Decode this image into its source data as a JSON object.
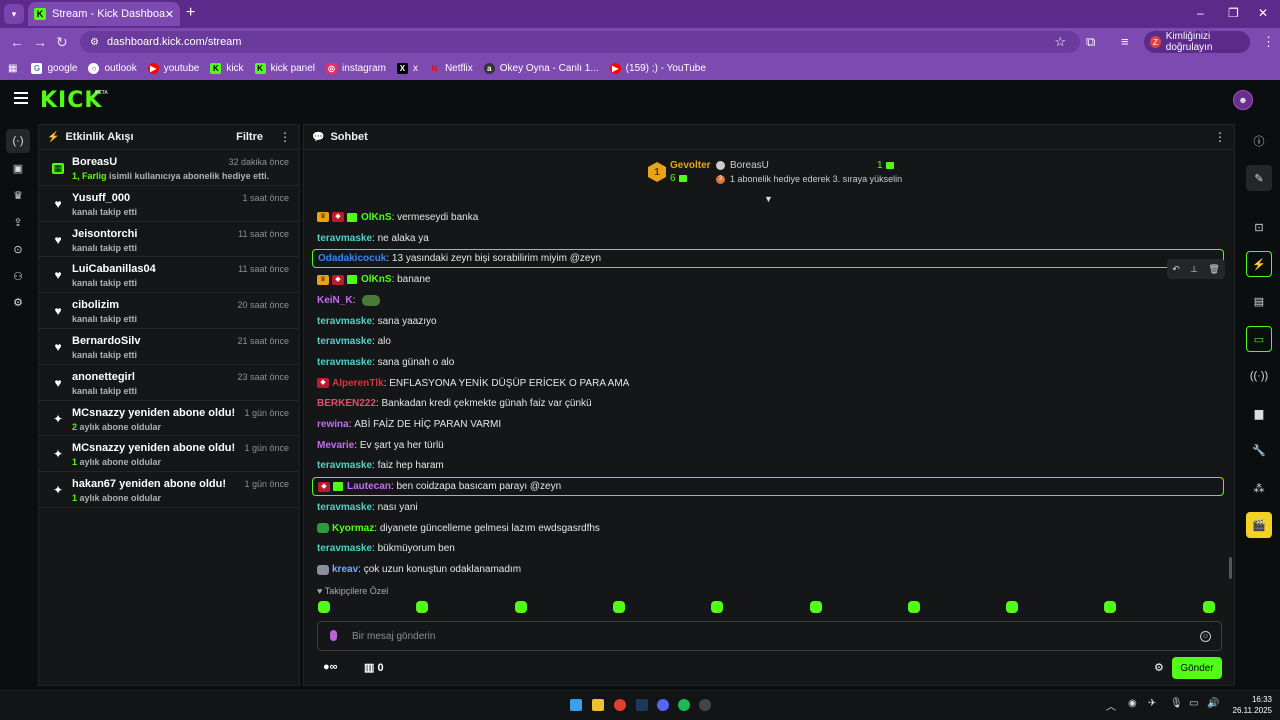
{
  "browser": {
    "tab_title": "Stream - Kick Dashboard",
    "url": "dashboard.kick.com/stream",
    "profile_label": "Kimliğinizi doğrulayın",
    "profile_initial": "Z",
    "bookmarks": [
      {
        "label": "google",
        "color": "#ffffff"
      },
      {
        "label": "outlook",
        "color": "#ffffff"
      },
      {
        "label": "youtube",
        "color": "#ff0000"
      },
      {
        "label": "kick",
        "color": "#53fc18"
      },
      {
        "label": "kick panel",
        "color": "#53fc18"
      },
      {
        "label": "instagram",
        "color": "#e1306c"
      },
      {
        "label": "x",
        "color": "#000000"
      },
      {
        "label": "Netflix",
        "color": "#e50914"
      },
      {
        "label": "Okey Oyna - Canlı 1...",
        "color": "#333333"
      },
      {
        "label": "(159) ;) - YouTube",
        "color": "#ff0000"
      }
    ]
  },
  "kick": {
    "logo": "KICK",
    "beta": "BETA"
  },
  "activity": {
    "title": "Etkinlik Akışı",
    "filter": "Filtre",
    "items": [
      {
        "name": "BoreasU",
        "sub_hl": "1, Farlig",
        "sub": " isimli kullanıcıya abonelik hediye etti.",
        "time": "32 dakika önce",
        "icon": "gift-icon"
      },
      {
        "name": "Yusuff_000",
        "sub_hl": "",
        "sub": "kanalı takip etti",
        "time": "1 saat önce",
        "icon": "heart-icon"
      },
      {
        "name": "Jeisontorchi",
        "sub_hl": "",
        "sub": "kanalı takip etti",
        "time": "11 saat önce",
        "icon": "heart-icon"
      },
      {
        "name": "LuiCabanillas04",
        "sub_hl": "",
        "sub": "kanalı takip etti",
        "time": "11 saat önce",
        "icon": "heart-icon"
      },
      {
        "name": "cibolizim",
        "sub_hl": "",
        "sub": "kanalı takip etti",
        "time": "20 saat önce",
        "icon": "heart-icon"
      },
      {
        "name": "BernardoSilv",
        "sub_hl": "",
        "sub": "kanalı takip etti",
        "time": "21 saat önce",
        "icon": "heart-icon"
      },
      {
        "name": "anonettegirl",
        "sub_hl": "",
        "sub": "kanalı takip etti",
        "time": "23 saat önce",
        "icon": "heart-icon"
      },
      {
        "name": "MCsnazzy yeniden abone oldu!",
        "sub_hl": "2",
        "sub": " aylık abone oldular",
        "time": "1 gün önce",
        "icon": "sparkle-icon"
      },
      {
        "name": "MCsnazzy yeniden abone oldu!",
        "sub_hl": "1",
        "sub": " aylık abone oldular",
        "time": "1 gün önce",
        "icon": "sparkle-icon"
      },
      {
        "name": "hakan67 yeniden abone oldu!",
        "sub_hl": "1",
        "sub": " aylık abone oldular",
        "time": "1 gün önce",
        "icon": "sparkle-icon"
      }
    ]
  },
  "chat": {
    "title": "Sohbet",
    "leaderboard": {
      "rank1": "1",
      "name1": "Gevolter",
      "count1": "6",
      "name2": "BoreasU",
      "count2": "1",
      "rank2": "3",
      "text2": "1 abonelik hediye ederek 3. sıraya yükselin"
    },
    "messages": [
      {
        "badges": [
          "crown",
          "red",
          "gift"
        ],
        "user": "OlKnS",
        "color": "#53fc18",
        "text": "vermeseydi banka",
        "hl": false
      },
      {
        "badges": [],
        "user": "teravmaske",
        "color": "#4fd1c5",
        "text": "ne alaka ya",
        "hl": false
      },
      {
        "badges": [],
        "user": "Odadakicocuk",
        "color": "#3b82f6",
        "text": "13 yasındaki zeyn bişi sorabilirim miyim @zeyn",
        "hl": true
      },
      {
        "badges": [
          "crown",
          "red",
          "gift"
        ],
        "user": "OlKnS",
        "color": "#53fc18",
        "text": "banane",
        "hl": false
      },
      {
        "badges": [],
        "user": "KeiN_K",
        "color": "#c46cf0",
        "text": "",
        "emote": true,
        "hl": false
      },
      {
        "badges": [],
        "user": "teravmaske",
        "color": "#4fd1c5",
        "text": "sana yaazıyo",
        "hl": false
      },
      {
        "badges": [],
        "user": "teravmaske",
        "color": "#4fd1c5",
        "text": "alo",
        "hl": false
      },
      {
        "badges": [],
        "user": "teravmaske",
        "color": "#4fd1c5",
        "text": "sana günah o alo",
        "hl": false
      },
      {
        "badges": [
          "red"
        ],
        "user": "AlperenTlk",
        "color": "#e0303a",
        "text": "ENFLASYONA YENİK DÜŞÜP ERİCEK O PARA AMA",
        "hl": false
      },
      {
        "badges": [],
        "user": "BERKEN222",
        "color": "#e0506a",
        "text": "Bankadan kredi çekmekte günah faiz var çünkü",
        "hl": false
      },
      {
        "badges": [],
        "user": "rewina",
        "color": "#c46cf0",
        "text": "ABİ FAİZ DE HİÇ PARAN VARMI",
        "hl": false
      },
      {
        "badges": [],
        "user": "Mevarie",
        "color": "#c46cf0",
        "text": "Ev şart ya her türlü",
        "hl": false
      },
      {
        "badges": [],
        "user": "teravmaske",
        "color": "#4fd1c5",
        "text": "faiz hep haram",
        "hl": false
      },
      {
        "badges": [
          "red",
          "gift"
        ],
        "user": "Lautecan",
        "color": "#c46cf0",
        "text": "ben coidzapa basıcam parayı @zeyn",
        "hl": true
      },
      {
        "badges": [],
        "user": "teravmaske",
        "color": "#4fd1c5",
        "text": "nası yani",
        "hl": false
      },
      {
        "badges": [
          "frog"
        ],
        "user": "Kyormaz",
        "color": "#53fc18",
        "text": "diyanete güncelleme gelmesi lazım ewdsgasrdfhs",
        "hl": false
      },
      {
        "badges": [],
        "user": "teravmaske",
        "color": "#4fd1c5",
        "text": "bükmüyorum ben",
        "hl": false
      },
      {
        "badges": [
          "cat"
        ],
        "user": "kreav",
        "color": "#7aa7ff",
        "text": "çok uzun konuştun odaklanamadım",
        "hl": false
      }
    ],
    "followers_label": "Takipçilere Özel",
    "input_placeholder": "Bir mesaj gönderin",
    "points": "∞",
    "store_count": "0",
    "send_label": "Gönder"
  },
  "taskbar": {
    "time": "16:33",
    "date": "26.11.2025"
  }
}
